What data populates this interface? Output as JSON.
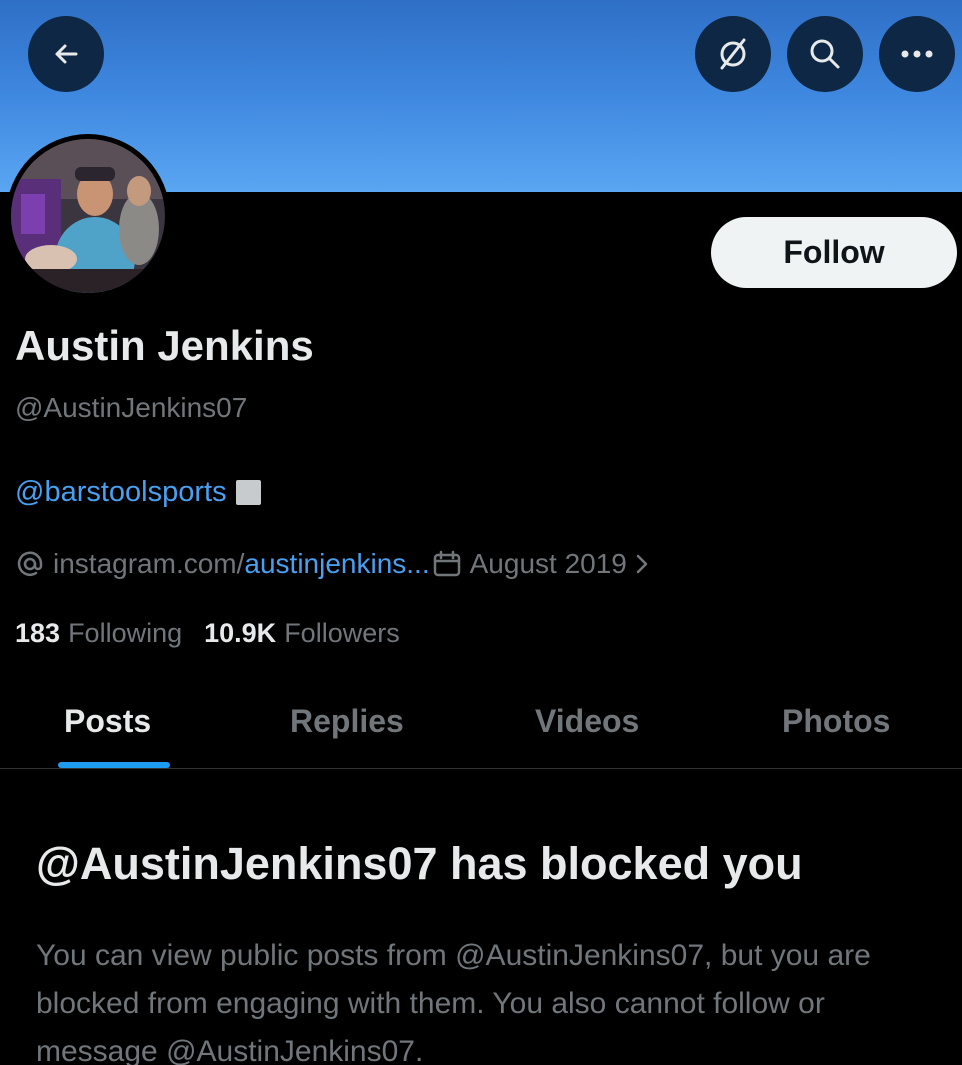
{
  "header": {
    "back_icon": "arrow-left-icon",
    "grok_icon": "slashed-circle-icon",
    "search_icon": "search-icon",
    "more_icon": "more-dots-icon",
    "banner_color": "#3f88e0"
  },
  "profile": {
    "name": "Austin Jenkins",
    "handle": "@AustinJenkins07",
    "bio_mention": "@barstoolsports",
    "website_prefix": "instagram.com/",
    "website_link": "austinjenkins...",
    "joined": "August 2019",
    "following_count": "183",
    "following_label": "Following",
    "followers_count": "10.9K",
    "followers_label": "Followers",
    "follow_label": "Follow"
  },
  "tabs": [
    {
      "label": "Posts",
      "active": true
    },
    {
      "label": "Replies",
      "active": false
    },
    {
      "label": "Videos",
      "active": false
    },
    {
      "label": "Photos",
      "active": false
    }
  ],
  "blocked": {
    "title": "@AustinJenkins07 has blocked you",
    "body": "You can view public posts from @AustinJenkins07, but you are blocked from engaging with them. You also cannot follow or message @AustinJenkins07."
  },
  "colors": {
    "accent": "#1d9bf0",
    "link": "#4a9ff0",
    "muted": "#71767b"
  }
}
